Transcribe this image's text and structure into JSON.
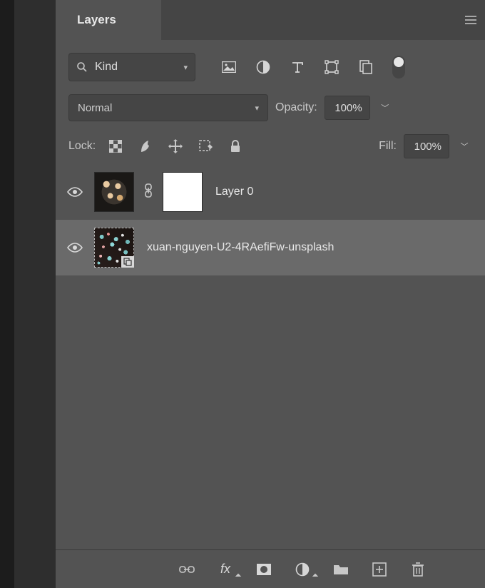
{
  "panel": {
    "title": "Layers"
  },
  "filter": {
    "label": "Kind"
  },
  "blend": {
    "mode": "Normal"
  },
  "opacity": {
    "label": "Opacity:",
    "value": "100%"
  },
  "lock": {
    "label": "Lock:"
  },
  "fill": {
    "label": "Fill:",
    "value": "100%"
  },
  "layers": [
    {
      "name": "Layer 0"
    },
    {
      "name": "xuan-nguyen-U2-4RAefiFw-unsplash"
    }
  ]
}
